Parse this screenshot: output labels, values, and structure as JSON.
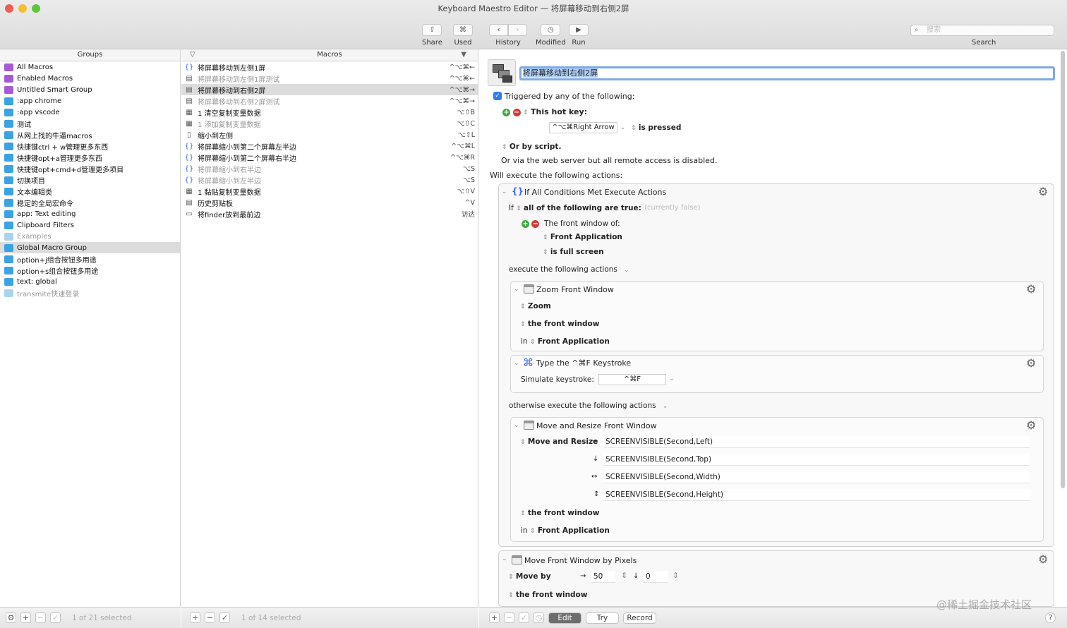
{
  "window": {
    "title": "Keyboard Maestro Editor — 将屏幕移动到右侧2屏"
  },
  "toolbar": {
    "share": "Share",
    "used": "Used",
    "history": "History",
    "modified": "Modified",
    "run": "Run",
    "search_placeholder": "搜索",
    "search_label": "Search"
  },
  "groups": {
    "header": "Groups",
    "items": [
      {
        "label": "All Macros",
        "color": "#a65bd6"
      },
      {
        "label": "Enabled Macros",
        "color": "#a65bd6"
      },
      {
        "label": "Untitled Smart Group",
        "color": "#a65bd6"
      },
      {
        "label": ":app chrome",
        "color": "#3aa3e3"
      },
      {
        "label": ":app vscode",
        "color": "#3aa3e3"
      },
      {
        "label": "测试",
        "color": "#3aa3e3"
      },
      {
        "label": "从网上找的牛逼macros",
        "color": "#3aa3e3"
      },
      {
        "label": "快捷键ctrl + w管理更多东西",
        "color": "#3aa3e3"
      },
      {
        "label": "快捷键opt+a管理更多东西",
        "color": "#3aa3e3"
      },
      {
        "label": "快捷键opt+cmd+d管理更多项目",
        "color": "#3aa3e3"
      },
      {
        "label": "切换项目",
        "color": "#3aa3e3"
      },
      {
        "label": "文本编辑类",
        "color": "#3aa3e3"
      },
      {
        "label": "稳定的全局宏命令",
        "color": "#3aa3e3"
      },
      {
        "label": "app: Text editing",
        "color": "#3aa3e3"
      },
      {
        "label": "Clipboard Filters",
        "color": "#3aa3e3"
      },
      {
        "label": "Examples",
        "color": "#a9d4f0"
      },
      {
        "label": "Global Macro Group",
        "color": "#3aa3e3"
      },
      {
        "label": "option+j组合按钮多用途",
        "color": "#3aa3e3"
      },
      {
        "label": "option+s组合按钮多用途",
        "color": "#3aa3e3"
      },
      {
        "label": "text: global",
        "color": "#3aa3e3"
      },
      {
        "label": "transmite快速登录",
        "color": "#a9d4f0"
      }
    ],
    "status": "1 of 21 selected"
  },
  "macros": {
    "header": "Macros",
    "items": [
      {
        "label": "将屏幕移动到左侧1屏",
        "key": "^⌥⌘←",
        "icon": "{}"
      },
      {
        "label": "将屏幕移动到左侧1屏测试",
        "key": "^⌥⌘←",
        "icon": "▤"
      },
      {
        "label": "将屏幕移动到右侧2屏",
        "key": "^⌥⌘→",
        "icon": "▤"
      },
      {
        "label": "将屏幕移动到右侧2屏测试",
        "key": "^⌥⌘→",
        "icon": "▤"
      },
      {
        "label": "1 清空复制变量数据",
        "key": "⌥⇧B",
        "icon": "▦"
      },
      {
        "label": "1 添加复制变量数据",
        "key": "⌥⇧C",
        "icon": "▦"
      },
      {
        "label": "缩小到左侧",
        "key": "⌥⇧L",
        "icon": "▯"
      },
      {
        "label": "将屏幕缩小到第二个屏幕左半边",
        "key": "^⌥⌘L",
        "icon": "{}"
      },
      {
        "label": "将屏幕缩小到第二个屏幕右半边",
        "key": "^⌥⌘R",
        "icon": "{}"
      },
      {
        "label": "将屏幕缩小到右半边",
        "key": "⌥S",
        "icon": "{}"
      },
      {
        "label": "将屏幕缩小到左半边",
        "key": "⌥S",
        "icon": "{}"
      },
      {
        "label": "1 黏贴复制变量数据",
        "key": "⌥⇧V",
        "icon": "▦"
      },
      {
        "label": "历史剪贴板",
        "key": "^V",
        "icon": "▤"
      },
      {
        "label": "将finder放到最前边",
        "key": "访达",
        "icon": "▭"
      }
    ],
    "status": "1 of 14 selected"
  },
  "editor": {
    "macro_name": "将屏幕移动到右侧2屏",
    "triggered_by": "Triggered by any of the following:",
    "hotkey_label": "This hot key:",
    "hotkey_value": "^⌥⌘Right Arrow",
    "hotkey_when": "is pressed",
    "or_script": "Or by script.",
    "web_server": "Or via the web server but all remote access is disabled.",
    "will_execute": "Will execute the following actions:",
    "if_block": {
      "title": "If All Conditions Met Execute Actions",
      "if_label": "If",
      "condition_mode": "all of the following are true:",
      "currently": "(currently false)",
      "front_window_of": "The front window of:",
      "front_application": "Front Application",
      "is_full_screen": "is full screen",
      "execute_label": "execute the following actions",
      "otherwise_label": "otherwise execute the following actions"
    },
    "zoom_action": {
      "title": "Zoom Front Window",
      "op": "Zoom",
      "target": "the front window",
      "in_label": "in",
      "app": "Front Application"
    },
    "type_action": {
      "title": "Type the ^⌘F Keystroke",
      "simulate_label": "Simulate keystroke:",
      "keystroke": "^⌘F"
    },
    "move_resize_action": {
      "title": "Move and Resize Front Window",
      "op": "Move and Resize",
      "left": "SCREENVISIBLE(Second,Left)",
      "top": "SCREENVISIBLE(Second,Top)",
      "width": "SCREENVISIBLE(Second,Width)",
      "height": "SCREENVISIBLE(Second,Height)",
      "target": "the front window",
      "in_label": "in",
      "app": "Front Application"
    },
    "move_pixels_action": {
      "title": "Move Front Window by Pixels",
      "op": "Move by",
      "dx": "50",
      "dy": "0",
      "target": "the front window"
    },
    "buttons": {
      "edit": "Edit",
      "try": "Try",
      "record": "Record"
    }
  },
  "watermark": "@稀土掘金技术社区"
}
